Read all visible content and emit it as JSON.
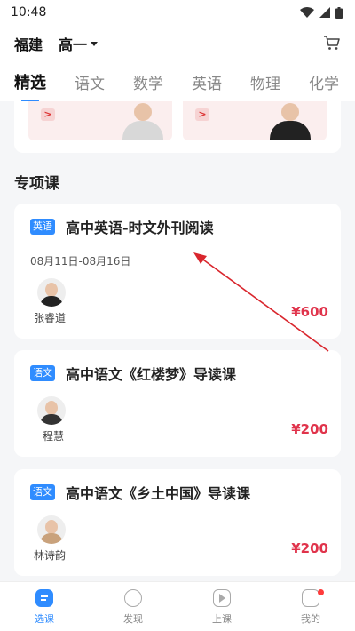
{
  "status_bar": {
    "time": "10:48"
  },
  "header": {
    "region": "福建",
    "grade": "高一"
  },
  "tabs": [
    {
      "label": "精选",
      "active": true
    },
    {
      "label": "语文",
      "active": false
    },
    {
      "label": "数学",
      "active": false
    },
    {
      "label": "英语",
      "active": false
    },
    {
      "label": "物理",
      "active": false
    },
    {
      "label": "化学",
      "active": false
    }
  ],
  "section": {
    "title": "专项课"
  },
  "courses": [
    {
      "tag": "英语",
      "title": "高中英语-时文外刊阅读",
      "date": "08月11日-08月16日",
      "teacher": "张睿道",
      "price": "¥600"
    },
    {
      "tag": "语文",
      "title": "高中语文《红楼梦》导读课",
      "date": "",
      "teacher": "程慧",
      "price": "¥200"
    },
    {
      "tag": "语文",
      "title": "高中语文《乡土中国》导读课",
      "date": "",
      "teacher": "林诗韵",
      "price": "¥200"
    }
  ],
  "bottom_nav": [
    {
      "label": "选课",
      "active": true
    },
    {
      "label": "发现",
      "active": false
    },
    {
      "label": "上课",
      "active": false
    },
    {
      "label": "我的",
      "active": false
    }
  ],
  "colors": {
    "accent": "#2f8cff",
    "price": "#e0334b",
    "annotation": "#d9262d"
  }
}
